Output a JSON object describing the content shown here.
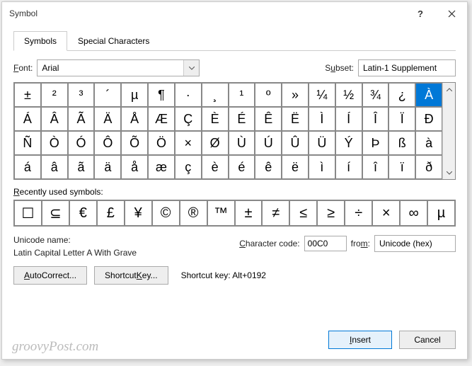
{
  "title": "Symbol",
  "tabs": {
    "symbols": "Symbols",
    "special": "Special Characters"
  },
  "font": {
    "label": "Font:",
    "value": "Arial"
  },
  "subset": {
    "label": "Subset:",
    "value": "Latin-1 Supplement"
  },
  "grid": [
    "±",
    "²",
    "³",
    "´",
    "µ",
    "¶",
    "·",
    "¸",
    "¹",
    "º",
    "»",
    "¼",
    "½",
    "¾",
    "¿",
    "À",
    "Á",
    "Â",
    "Ã",
    "Ä",
    "Å",
    "Æ",
    "Ç",
    "È",
    "É",
    "Ê",
    "Ë",
    "Ì",
    "Í",
    "Î",
    "Ï",
    "Ð",
    "Ñ",
    "Ò",
    "Ó",
    "Ô",
    "Õ",
    "Ö",
    "×",
    "Ø",
    "Ù",
    "Ú",
    "Û",
    "Ü",
    "Ý",
    "Þ",
    "ß",
    "à",
    "á",
    "â",
    "ã",
    "ä",
    "å",
    "æ",
    "ç",
    "è",
    "é",
    "ê",
    "ë",
    "ì",
    "í",
    "î",
    "ï",
    "ð"
  ],
  "selected_index": 15,
  "recent_label": "Recently used symbols:",
  "recent": [
    "☐",
    "⊆",
    "€",
    "£",
    "¥",
    "©",
    "®",
    "™",
    "±",
    "≠",
    "≤",
    "≥",
    "÷",
    "×",
    "∞",
    "µ"
  ],
  "unicode_name_label": "Unicode name:",
  "unicode_name": "Latin Capital Letter A With Grave",
  "charcode_label": "Character code:",
  "charcode": "00C0",
  "from_label": "from:",
  "from_value": "Unicode (hex)",
  "buttons": {
    "autocorrect": "AutoCorrect...",
    "shortcut": "Shortcut Key...",
    "insert": "Insert",
    "cancel": "Cancel"
  },
  "shortcut_text": "Shortcut key: Alt+0192",
  "watermark": "groovyPost.com"
}
